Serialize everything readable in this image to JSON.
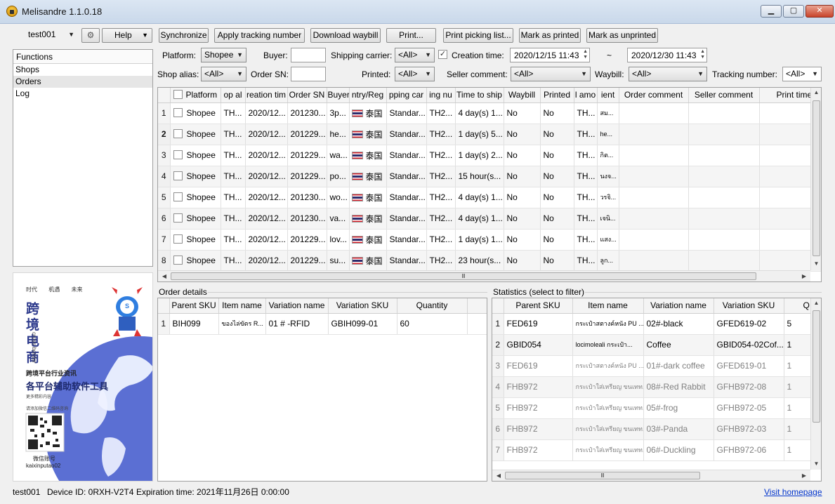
{
  "window": {
    "title": "Melisandre 1.1.0.18",
    "min_label": "▁",
    "max_label": "▢",
    "close_label": "✕"
  },
  "toolbar": {
    "account": "test001",
    "help_label": "Help",
    "buttons": [
      "Synchronize",
      "Apply tracking number",
      "Download waybill",
      "Print...",
      "Print picking list...",
      "Mark as printed",
      "Mark as unprinted"
    ]
  },
  "filters": {
    "platform_label": "Platform:",
    "platform_value": "Shopee",
    "buyer_label": "Buyer:",
    "carrier_label": "Shipping carrier:",
    "carrier_value": "<All>",
    "creation_time_label": "Creation time:",
    "creation_from": "2020/12/15 11:43",
    "range_sep": "~",
    "creation_to": "2020/12/30 11:43",
    "shop_alias_label": "Shop alias:",
    "shop_alias_value": "<All>",
    "order_sn_label": "Order SN:",
    "printed_label": "Printed:",
    "printed_value": "<All>",
    "seller_comment_label": "Seller comment:",
    "seller_comment_value": "<All>",
    "waybill_label": "Waybill:",
    "waybill_value": "<All>",
    "tracking_label": "Tracking number:",
    "tracking_value": "<All>"
  },
  "functions": {
    "header": "Functions",
    "items": [
      "Shops",
      "Orders",
      "Log"
    ]
  },
  "ad": {
    "top_tags": [
      "时代",
      "机遇",
      "未来"
    ],
    "big_chars": [
      "跨",
      "境",
      "电",
      "商"
    ],
    "vertical_en": "cross border",
    "line1": "跨境平台行业资讯",
    "line2": "各平台辅助软件工具",
    "line3": "更多精彩内容",
    "line4": "请添加微信二维码咨询",
    "wechat_label": "微信账号",
    "wechat_id": "kaixinputao02",
    "mascot_letter": "S"
  },
  "orders": {
    "columns": [
      "Platform",
      "op al",
      "reation tim",
      "Order SN",
      "Buyer",
      "ntry/Reg",
      "pping car",
      "ing nu",
      "Time to ship",
      "Waybill",
      "Printed",
      "l amo",
      "ient",
      "Order comment",
      "Seller comment",
      "Print time"
    ],
    "rows": [
      {
        "n": "1",
        "platform": "Shopee",
        "shop": "TH...",
        "created": "2020/12...",
        "sn": "201230...",
        "buyer": "3p...",
        "country": "泰国",
        "carrier": "Standar...",
        "tracking": "TH2...",
        "ship": "4 day(s) 1...",
        "waybill": "No",
        "printed": "No",
        "amount": "TH...",
        "recipient": "สม..."
      },
      {
        "n": "2",
        "platform": "Shopee",
        "shop": "TH...",
        "created": "2020/12...",
        "sn": "201229...",
        "buyer": "he...",
        "country": "泰国",
        "carrier": "Standar...",
        "tracking": "TH2...",
        "ship": "1 day(s) 5...",
        "waybill": "No",
        "printed": "No",
        "amount": "TH...",
        "recipient": "he..."
      },
      {
        "n": "3",
        "platform": "Shopee",
        "shop": "TH...",
        "created": "2020/12...",
        "sn": "201229...",
        "buyer": "wa...",
        "country": "泰国",
        "carrier": "Standar...",
        "tracking": "TH2...",
        "ship": "1 day(s) 2...",
        "waybill": "No",
        "printed": "No",
        "amount": "TH...",
        "recipient": "กิต..."
      },
      {
        "n": "4",
        "platform": "Shopee",
        "shop": "TH...",
        "created": "2020/12...",
        "sn": "201229...",
        "buyer": "po...",
        "country": "泰国",
        "carrier": "Standar...",
        "tracking": "TH2...",
        "ship": "15 hour(s...",
        "waybill": "No",
        "printed": "No",
        "amount": "TH...",
        "recipient": "นงจ..."
      },
      {
        "n": "5",
        "platform": "Shopee",
        "shop": "TH...",
        "created": "2020/12...",
        "sn": "201230...",
        "buyer": "wo...",
        "country": "泰国",
        "carrier": "Standar...",
        "tracking": "TH2...",
        "ship": "4 day(s) 1...",
        "waybill": "No",
        "printed": "No",
        "amount": "TH...",
        "recipient": "วรจิ..."
      },
      {
        "n": "6",
        "platform": "Shopee",
        "shop": "TH...",
        "created": "2020/12...",
        "sn": "201230...",
        "buyer": "va...",
        "country": "泰国",
        "carrier": "Standar...",
        "tracking": "TH2...",
        "ship": "4 day(s) 1...",
        "waybill": "No",
        "printed": "No",
        "amount": "TH...",
        "recipient": "เจนิ..."
      },
      {
        "n": "7",
        "platform": "Shopee",
        "shop": "TH...",
        "created": "2020/12...",
        "sn": "201229...",
        "buyer": "lov...",
        "country": "泰国",
        "carrier": "Standar...",
        "tracking": "TH2...",
        "ship": "1 day(s) 1...",
        "waybill": "No",
        "printed": "No",
        "amount": "TH...",
        "recipient": "แสง..."
      },
      {
        "n": "8",
        "platform": "Shopee",
        "shop": "TH...",
        "created": "2020/12...",
        "sn": "201229...",
        "buyer": "su...",
        "country": "泰国",
        "carrier": "Standar...",
        "tracking": "TH2...",
        "ship": "23 hour(s...",
        "waybill": "No",
        "printed": "No",
        "amount": "TH...",
        "recipient": "ลูก..."
      }
    ]
  },
  "order_details": {
    "title": "Order details",
    "columns": [
      "Parent SKU",
      "Item name",
      "Variation name",
      "Variation SKU",
      "Quantity"
    ],
    "rows": [
      {
        "n": "1",
        "parent": "BIH099",
        "item": "ของไล่ขัตร R...",
        "variation": "01 # -RFID",
        "vsku": "GBIH099-01",
        "qty": "60"
      }
    ]
  },
  "statistics": {
    "title": "Statistics (select to filter)",
    "columns": [
      "Parent SKU",
      "Item name",
      "Variation name",
      "Variation SKU",
      "Q"
    ],
    "rows": [
      {
        "n": "1",
        "parent": "FED619",
        "item": "กระเป๋าสตางค์หนัง PU ...",
        "variation": "02#-black",
        "vsku": "GFED619-02",
        "qty": "5"
      },
      {
        "n": "2",
        "parent": "GBID054",
        "item": "locimoleali กระเป๋า...",
        "variation": "Coffee",
        "vsku": "GBID054-02Cof...",
        "qty": "1"
      },
      {
        "n": "3",
        "parent": "FED619",
        "item": "กระเป๋าสตางค์หนัง PU ...",
        "variation": "01#-dark coffee",
        "vsku": "GFED619-01",
        "qty": "1"
      },
      {
        "n": "4",
        "parent": "FHB972",
        "item": "กระเป๋าใส่เหรียญ ขนเทท...",
        "variation": "08#-Red Rabbit",
        "vsku": "GFHB972-08",
        "qty": "1"
      },
      {
        "n": "5",
        "parent": "FHB972",
        "item": "กระเป๋าใส่เหรียญ ขนเทท...",
        "variation": "05#-frog",
        "vsku": "GFHB972-05",
        "qty": "1"
      },
      {
        "n": "6",
        "parent": "FHB972",
        "item": "กระเป๋าใส่เหรียญ ขนเทท...",
        "variation": "03#-Panda",
        "vsku": "GFHB972-03",
        "qty": "1"
      },
      {
        "n": "7",
        "parent": "FHB972",
        "item": "กระเป๋าใส่เหรียญ ขนเทท...",
        "variation": "06#-Duckling",
        "vsku": "GFHB972-06",
        "qty": "1"
      }
    ]
  },
  "status_bar": {
    "account": "test001",
    "device": "Device ID: 0RXH-V2T4",
    "expiration": "Expiration time: 2021年11月26日 0:00:00",
    "homepage": "Visit homepage"
  }
}
